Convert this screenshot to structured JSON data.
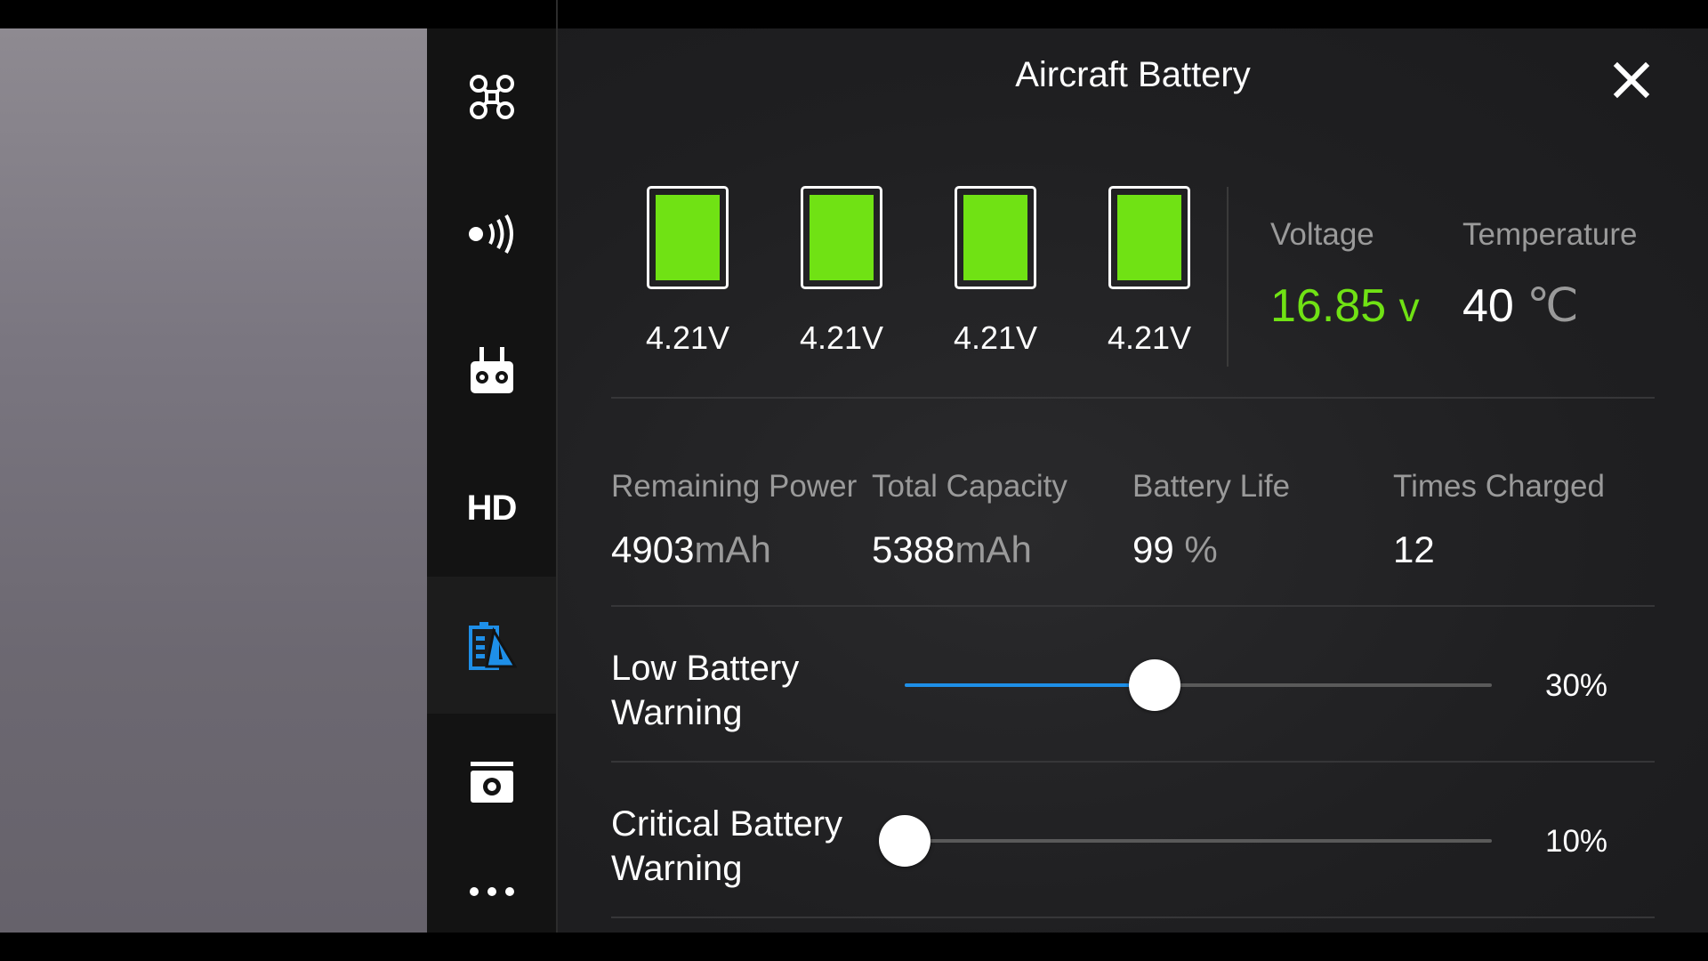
{
  "panel": {
    "title": "Aircraft Battery",
    "close_icon": "close-icon"
  },
  "sidebar": {
    "items": [
      {
        "icon": "aircraft-icon",
        "active": false
      },
      {
        "icon": "signal-icon",
        "active": false
      },
      {
        "icon": "remote-controller-icon",
        "active": false
      },
      {
        "icon": "hd-icon",
        "label": "HD",
        "active": false
      },
      {
        "icon": "battery-icon",
        "active": true
      },
      {
        "icon": "camera-icon",
        "active": false
      },
      {
        "icon": "more-icon",
        "active": false
      }
    ]
  },
  "cells": [
    {
      "voltage": "4.21V"
    },
    {
      "voltage": "4.21V"
    },
    {
      "voltage": "4.21V"
    },
    {
      "voltage": "4.21V"
    }
  ],
  "voltage": {
    "label": "Voltage",
    "value": "16.85",
    "unit": "v"
  },
  "temperature": {
    "label": "Temperature",
    "value": "40",
    "unit": "℃"
  },
  "info": {
    "remaining_power": {
      "label": "Remaining Power",
      "value": "4903",
      "unit": "mAh"
    },
    "total_capacity": {
      "label": "Total Capacity",
      "value": "5388",
      "unit": "mAh"
    },
    "battery_life": {
      "label": "Battery Life",
      "value": "99",
      "unit": "%"
    },
    "times_charged": {
      "label": "Times Charged",
      "value": "12"
    }
  },
  "warnings": {
    "low": {
      "label_line1": "Low Battery",
      "label_line2": "Warning",
      "value_text": "30%",
      "level": 0.425
    },
    "critical": {
      "label_line1": "Critical Battery",
      "label_line2": "Warning",
      "value_text": "10%",
      "level": 0.0
    }
  },
  "colors": {
    "accent": "#1e8fe8",
    "cell_green": "#70e214",
    "voltage_green": "#70e214",
    "panel_bg": "#1f1f21",
    "sidebar_bg": "#131313"
  }
}
